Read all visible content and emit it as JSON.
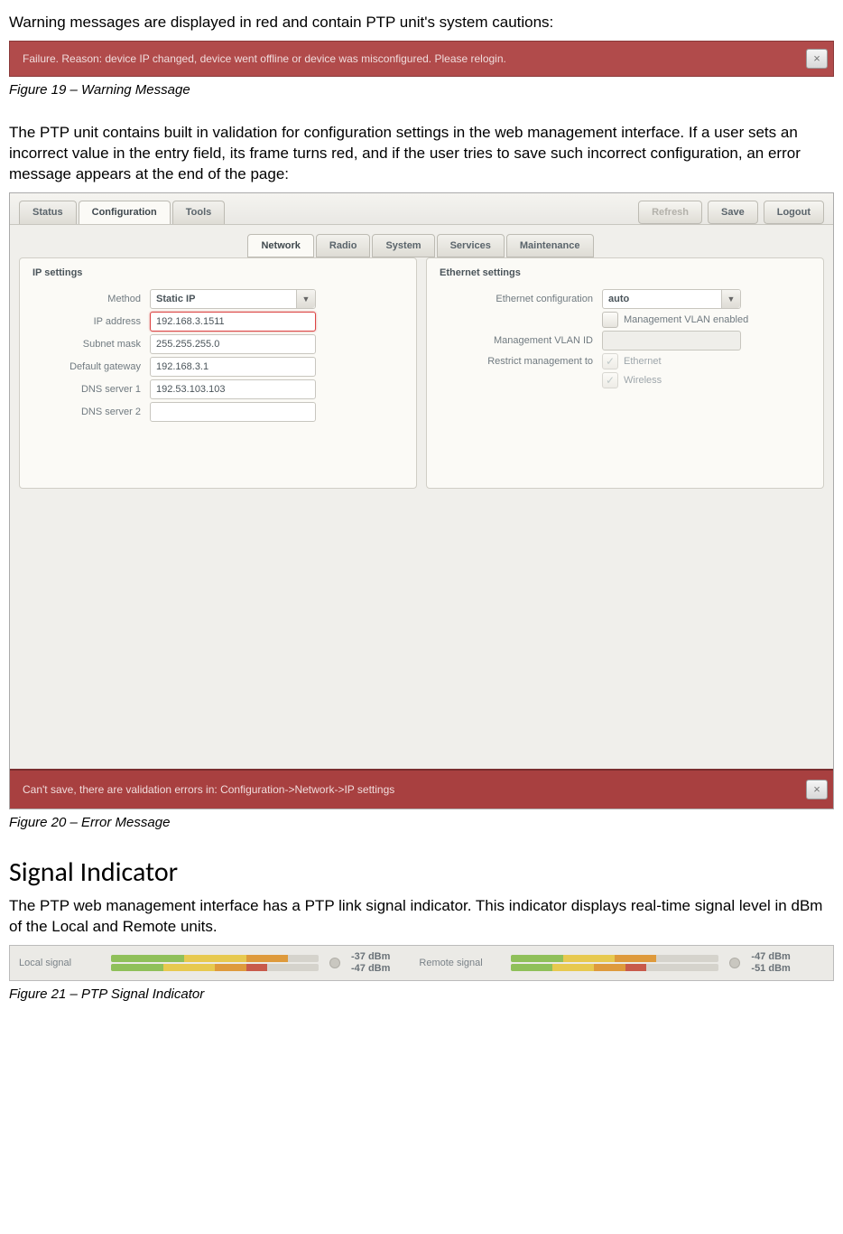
{
  "intro_warning": "Warning messages are displayed in red and contain PTP unit's system cautions:",
  "banner1": {
    "text": "Failure. Reason: device IP changed, device went offline or device was misconfigured. Please relogin.",
    "close": "×"
  },
  "fig19": "Figure 19 – Warning Message",
  "para2": "The PTP unit contains built in validation for configuration settings in the web management interface. If a user sets an incorrect value in the entry field, its frame turns red, and if the user tries to save such incorrect configuration, an error message appears at the end of the page:",
  "config": {
    "main_tabs": [
      "Status",
      "Configuration",
      "Tools"
    ],
    "right_buttons": [
      "Refresh",
      "Save",
      "Logout"
    ],
    "sub_tabs": [
      "Network",
      "Radio",
      "System",
      "Services",
      "Maintenance"
    ],
    "ip": {
      "title": "IP settings",
      "rows": {
        "method_label": "Method",
        "method_value": "Static IP",
        "ip_label": "IP address",
        "ip_value": "192.168.3.1511",
        "mask_label": "Subnet mask",
        "mask_value": "255.255.255.0",
        "gw_label": "Default gateway",
        "gw_value": "192.168.3.1",
        "dns1_label": "DNS server 1",
        "dns1_value": "192.53.103.103",
        "dns2_label": "DNS server 2",
        "dns2_value": ""
      }
    },
    "eth": {
      "title": "Ethernet settings",
      "cfg_label": "Ethernet configuration",
      "cfg_value": "auto",
      "vlan_enabled_label": "Management VLAN enabled",
      "vlan_id_label": "Management VLAN ID",
      "vlan_id_value": "",
      "restrict_label": "Restrict management to",
      "restrict_eth": "Ethernet",
      "restrict_wl": "Wireless"
    }
  },
  "error_banner": {
    "text": "Can't save, there are validation errors in: Configuration->Network->IP settings",
    "close": "×"
  },
  "fig20": "Figure 20 – Error Message",
  "section_heading": "Signal Indicator",
  "para3": "The PTP web management interface has a PTP link signal indicator. This indicator displays real-time signal level in dBm of the Local and Remote units.",
  "signal": {
    "local_label": "Local signal",
    "local_top": "-37 dBm",
    "local_bot": "-47 dBm",
    "remote_label": "Remote signal",
    "remote_top": "-47 dBm",
    "remote_bot": "-51 dBm"
  },
  "fig21": "Figure 21 – PTP Signal Indicator"
}
